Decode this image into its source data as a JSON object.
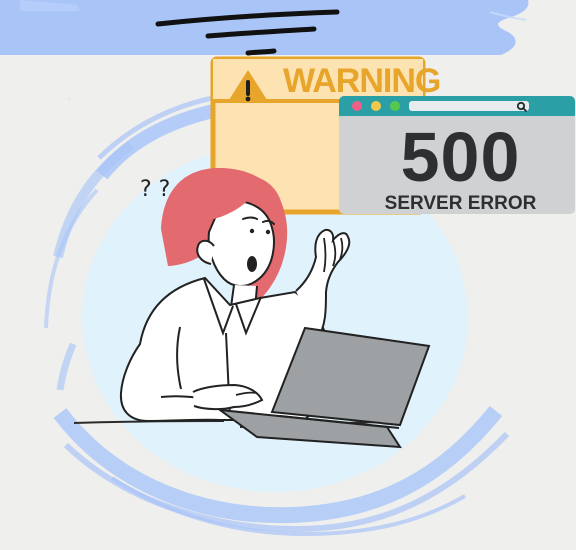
{
  "warning_box": {
    "label": "WARNING",
    "icon": "warning-triangle-icon"
  },
  "error_window": {
    "code": "500",
    "message": "SERVER ERROR",
    "dots": [
      "#f05f8a",
      "#f0c84b",
      "#57c84e"
    ],
    "icon": "search-icon"
  },
  "person": {
    "thought": "? ?"
  },
  "colors": {
    "accent_blue": "#a9c5f8",
    "bubble_blue": "#e0f2fb",
    "warning_orange": "#e7a52b",
    "warning_fill": "#fde3b1",
    "browser_bar": "#2b9fa6",
    "hair": "#e36a6e",
    "shirt": "#ffffff",
    "laptop": "#9ea1a3"
  }
}
